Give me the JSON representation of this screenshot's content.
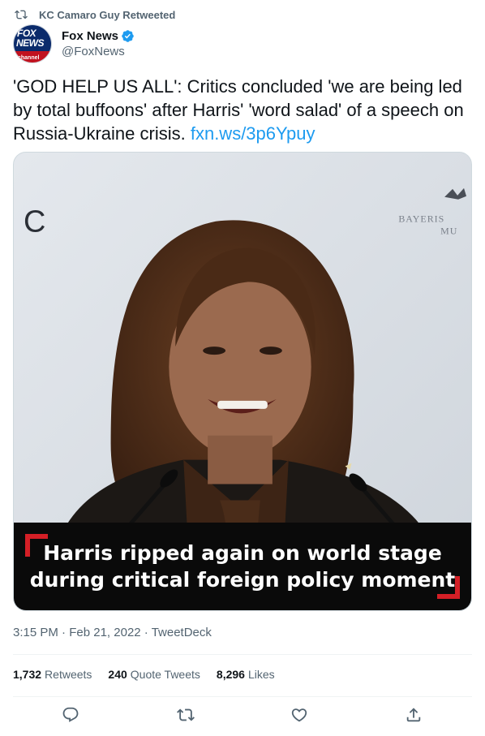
{
  "retweet": {
    "label": "KC Camaro Guy Retweeted",
    "icon": "retweet-icon"
  },
  "author": {
    "display_name": "Fox News",
    "handle": "@FoxNews",
    "verified": true,
    "avatar": {
      "line1": "FOX",
      "line2": "NEWS",
      "line3": "channel"
    }
  },
  "tweet": {
    "text": "'GOD HELP US ALL': Critics concluded 'we are being led by total buffoons' after Harris' 'word salad' of a speech on Russia-Ukraine crisis.",
    "link": "fxn.ws/3p6Ypuy"
  },
  "media": {
    "caption_line1": "Harris ripped again on world stage",
    "caption_line2": "during critical foreign policy moment",
    "bg_letter": "C",
    "bg_text1": "BAYERIS",
    "bg_text2": "MU"
  },
  "meta": {
    "time": "3:15 PM",
    "separator": "·",
    "date": "Feb 21, 2022",
    "source": "TweetDeck"
  },
  "stats": [
    {
      "count": "1,732",
      "label": "Retweets"
    },
    {
      "count": "240",
      "label": "Quote Tweets"
    },
    {
      "count": "8,296",
      "label": "Likes"
    }
  ],
  "actions": [
    {
      "name": "reply",
      "icon": "reply-icon"
    },
    {
      "name": "retweet",
      "icon": "retweet-icon"
    },
    {
      "name": "like",
      "icon": "heart-icon"
    },
    {
      "name": "share",
      "icon": "share-icon"
    }
  ],
  "colors": {
    "accent": "#1d9bf0",
    "muted": "#536471",
    "caption_bg": "#0a0a0a",
    "corner_red": "#d41f26"
  }
}
